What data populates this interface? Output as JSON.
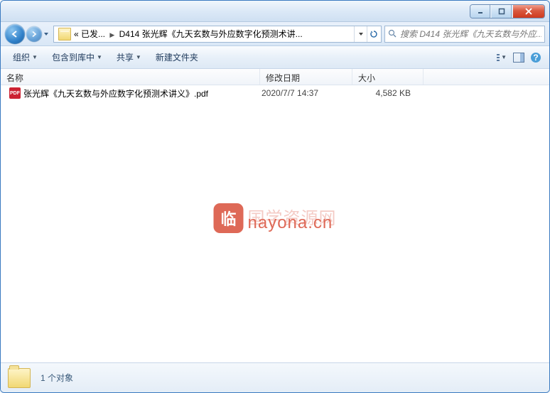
{
  "breadcrumb": {
    "prefix": "« 已发...",
    "current": "D414 张光辉《九天玄数与外应数字化预测术讲..."
  },
  "search": {
    "placeholder": "搜索 D414 张光辉《九天玄数与外应..."
  },
  "toolbar": {
    "organize": "组织",
    "include": "包含到库中",
    "share": "共享",
    "newfolder": "新建文件夹"
  },
  "columns": {
    "name": "名称",
    "date": "修改日期",
    "size": "大小"
  },
  "files": [
    {
      "icon": "PDF",
      "name": "张光辉《九天玄数与外应数字化预测术讲义》.pdf",
      "date": "2020/7/7 14:37",
      "size": "4,582 KB"
    }
  ],
  "status": {
    "text": "1 个对象"
  },
  "watermark": {
    "badge": "临",
    "text1": "国学资源网",
    "text2": "nayona.cn"
  }
}
